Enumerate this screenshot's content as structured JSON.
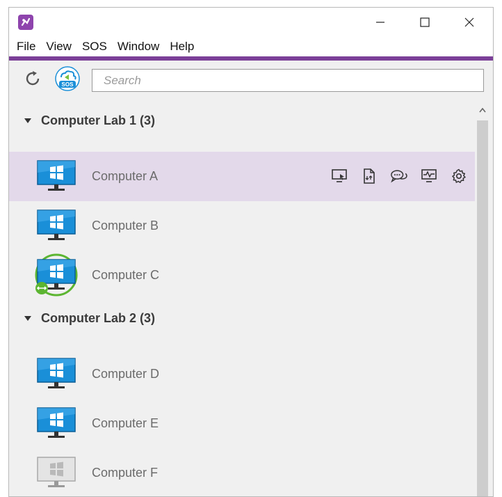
{
  "menu": {
    "items": [
      "File",
      "View",
      "SOS",
      "Window",
      "Help"
    ]
  },
  "toolbar": {
    "refresh_icon": "refresh-icon",
    "sos_label": "SOS",
    "search_placeholder": "Search"
  },
  "groups": [
    {
      "title": "Computer Lab 1 (3)",
      "computers": [
        {
          "name": "Computer A",
          "state": "selected"
        },
        {
          "name": "Computer B",
          "state": "online"
        },
        {
          "name": "Computer C",
          "state": "connected"
        }
      ]
    },
    {
      "title": "Computer Lab 2 (3)",
      "computers": [
        {
          "name": "Computer D",
          "state": "online"
        },
        {
          "name": "Computer E",
          "state": "online"
        },
        {
          "name": "Computer F",
          "state": "offline"
        }
      ]
    }
  ],
  "row_actions": [
    "remote-control-icon",
    "file-transfer-icon",
    "chat-icon",
    "system-monitor-icon",
    "settings-gear-icon"
  ],
  "colors": {
    "accent": "#7b3f98",
    "selected_row": "#e3d9ea",
    "monitor_online": "#1a8fd8",
    "connected_ring": "#5cb531"
  }
}
